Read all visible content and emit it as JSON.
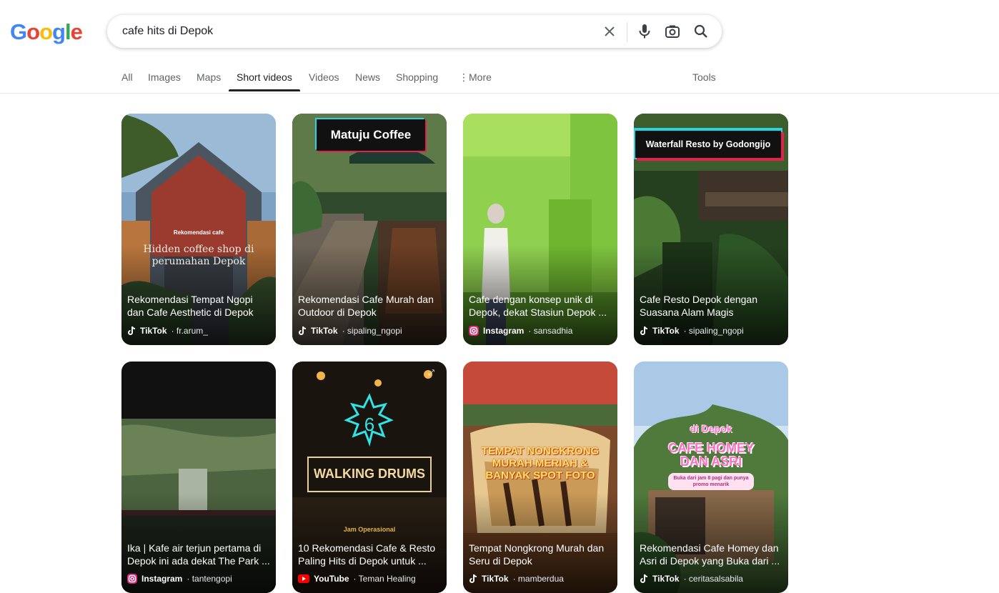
{
  "logo": {
    "letters": [
      "G",
      "o",
      "o",
      "g",
      "l",
      "e"
    ],
    "colors": [
      "#4285F4",
      "#EA4335",
      "#FBBC05",
      "#4285F4",
      "#34A853",
      "#EA4335"
    ]
  },
  "search": {
    "query": "cafe hits di Depok"
  },
  "tabs": [
    {
      "label": "All"
    },
    {
      "label": "Images"
    },
    {
      "label": "Maps"
    },
    {
      "label": "Short videos"
    },
    {
      "label": "Videos"
    },
    {
      "label": "News"
    },
    {
      "label": "Shopping"
    },
    {
      "label": "More"
    }
  ],
  "tools_label": "Tools",
  "results": [
    {
      "title": "Rekomendasi Tempat Ngopi dan Cafe Aesthetic di Depok",
      "platform": "TikTok",
      "author": "· fr.arum_",
      "overlay_small": "Rekomendasi cafe",
      "overlay_big": "Hidden coffee shop di perumahan Depok"
    },
    {
      "title": "Rekomendasi Cafe Murah dan Outdoor di Depok",
      "platform": "TikTok",
      "author": "· sipaling_ngopi",
      "badge": "Matuju Coffee"
    },
    {
      "title": "Cafe dengan konsep unik di Depok, dekat Stasiun Depok ...",
      "platform": "Instagram",
      "author": "· sansadhia"
    },
    {
      "title": "Cafe Resto Depok dengan Suasana Alam Magis",
      "platform": "TikTok",
      "author": "· sipaling_ngopi",
      "badge": "Waterfall Resto by Godongijo"
    },
    {
      "title": "Ika | Kafe air terjun pertama di Depok ini ada dekat The Park ...",
      "platform": "Instagram",
      "author": "· tantengopi"
    },
    {
      "title": "10 Rekomendasi Cafe & Resto Paling Hits di Depok untuk ...",
      "platform": "YouTube",
      "author": "· Teman Healing",
      "sign_number": "6",
      "sign_text": "WALKING DRUMS",
      "sign_sub": "Jam Operasional"
    },
    {
      "title": "Tempat Nongkrong Murah dan Seru di Depok",
      "platform": "TikTok",
      "author": "· mamberdua",
      "overlay_big": "TEMPAT NONGKRONG MURAH MERIAH & BANYAK SPOT FOTO"
    },
    {
      "title": "Rekomendasi Cafe Homey dan Asri di Depok yang Buka dari ...",
      "platform": "TikTok",
      "author": "· ceritasalsabila",
      "overlay_small": "di Depok",
      "overlay_big": "CAFE HOMEY DAN ASRI",
      "overlay_note": "Buka dari jam 8 pagi dan punya promo menarik"
    }
  ]
}
